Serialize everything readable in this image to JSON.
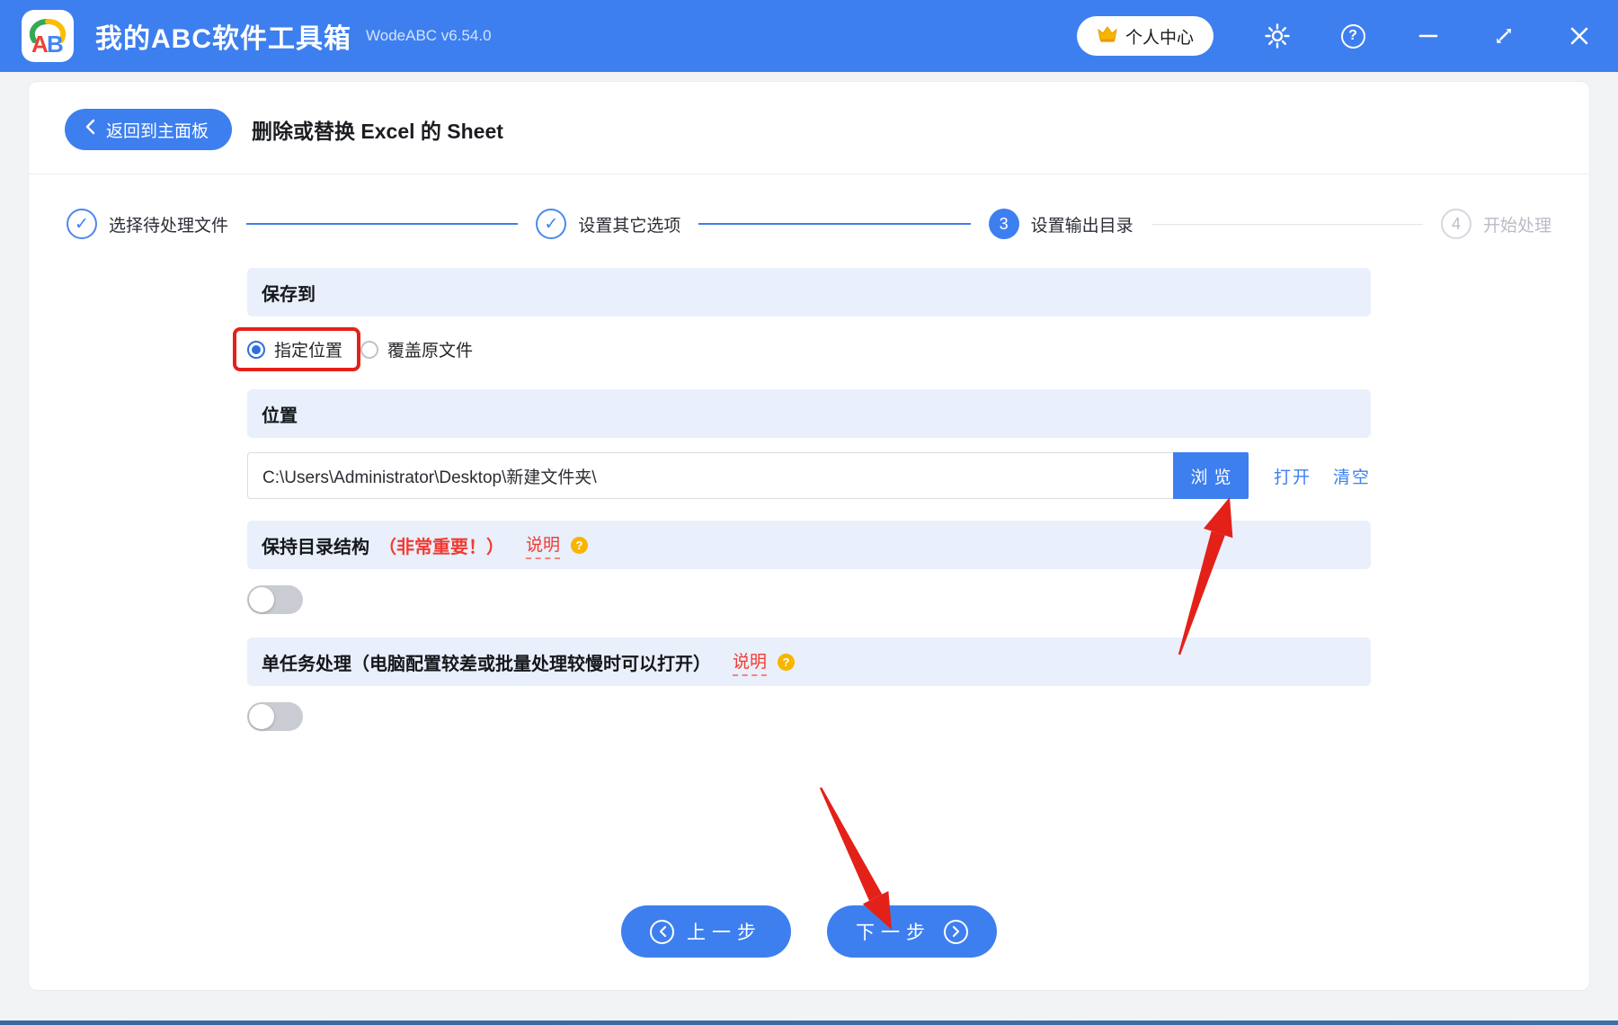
{
  "titlebar": {
    "app_title": "我的ABC软件工具箱",
    "version": "WodeABC v6.54.0",
    "user_center_label": "个人中心",
    "icons": [
      "crown-icon",
      "gear-icon",
      "help-icon",
      "minimize-icon",
      "maximize-icon",
      "close-icon"
    ]
  },
  "toolbar": {
    "back_label": "返回到主面板",
    "page_title": "删除或替换 Excel 的 Sheet"
  },
  "steps": [
    {
      "label": "选择待处理文件",
      "glyph": "✓",
      "state": "done"
    },
    {
      "label": "设置其它选项",
      "glyph": "✓",
      "state": "done"
    },
    {
      "label": "设置输出目录",
      "glyph": "3",
      "state": "active"
    },
    {
      "label": "开始处理",
      "glyph": "4",
      "state": "pending"
    }
  ],
  "save_to": {
    "header": "保存到",
    "options": [
      {
        "label": "指定位置",
        "selected": true,
        "highlighted_by_red_box": true
      },
      {
        "label": "覆盖原文件",
        "selected": false
      }
    ]
  },
  "location": {
    "header": "位置",
    "path_value": "C:\\Users\\Administrator\\Desktop\\新建文件夹\\",
    "browse_label": "浏览",
    "open_label": "打开",
    "clear_label": "清空"
  },
  "keep_structure": {
    "title": "保持目录结构",
    "important_note": "（非常重要！）",
    "help_label": "说明",
    "toggle_on": false
  },
  "single_task": {
    "title": "单任务处理（电脑配置较差或批量处理较慢时可以打开）",
    "help_label": "说明",
    "toggle_on": false
  },
  "footer": {
    "prev_label": "上一步",
    "next_label": "下一步"
  },
  "colors": {
    "primary_blue": "#3e7fef",
    "section_header_bg": "#e9effb",
    "annotation_red": "#e32119",
    "warning_red_text": "#f23a30",
    "help_badge_orange": "#f7b500",
    "pending_gray": "#b9bdc4"
  }
}
